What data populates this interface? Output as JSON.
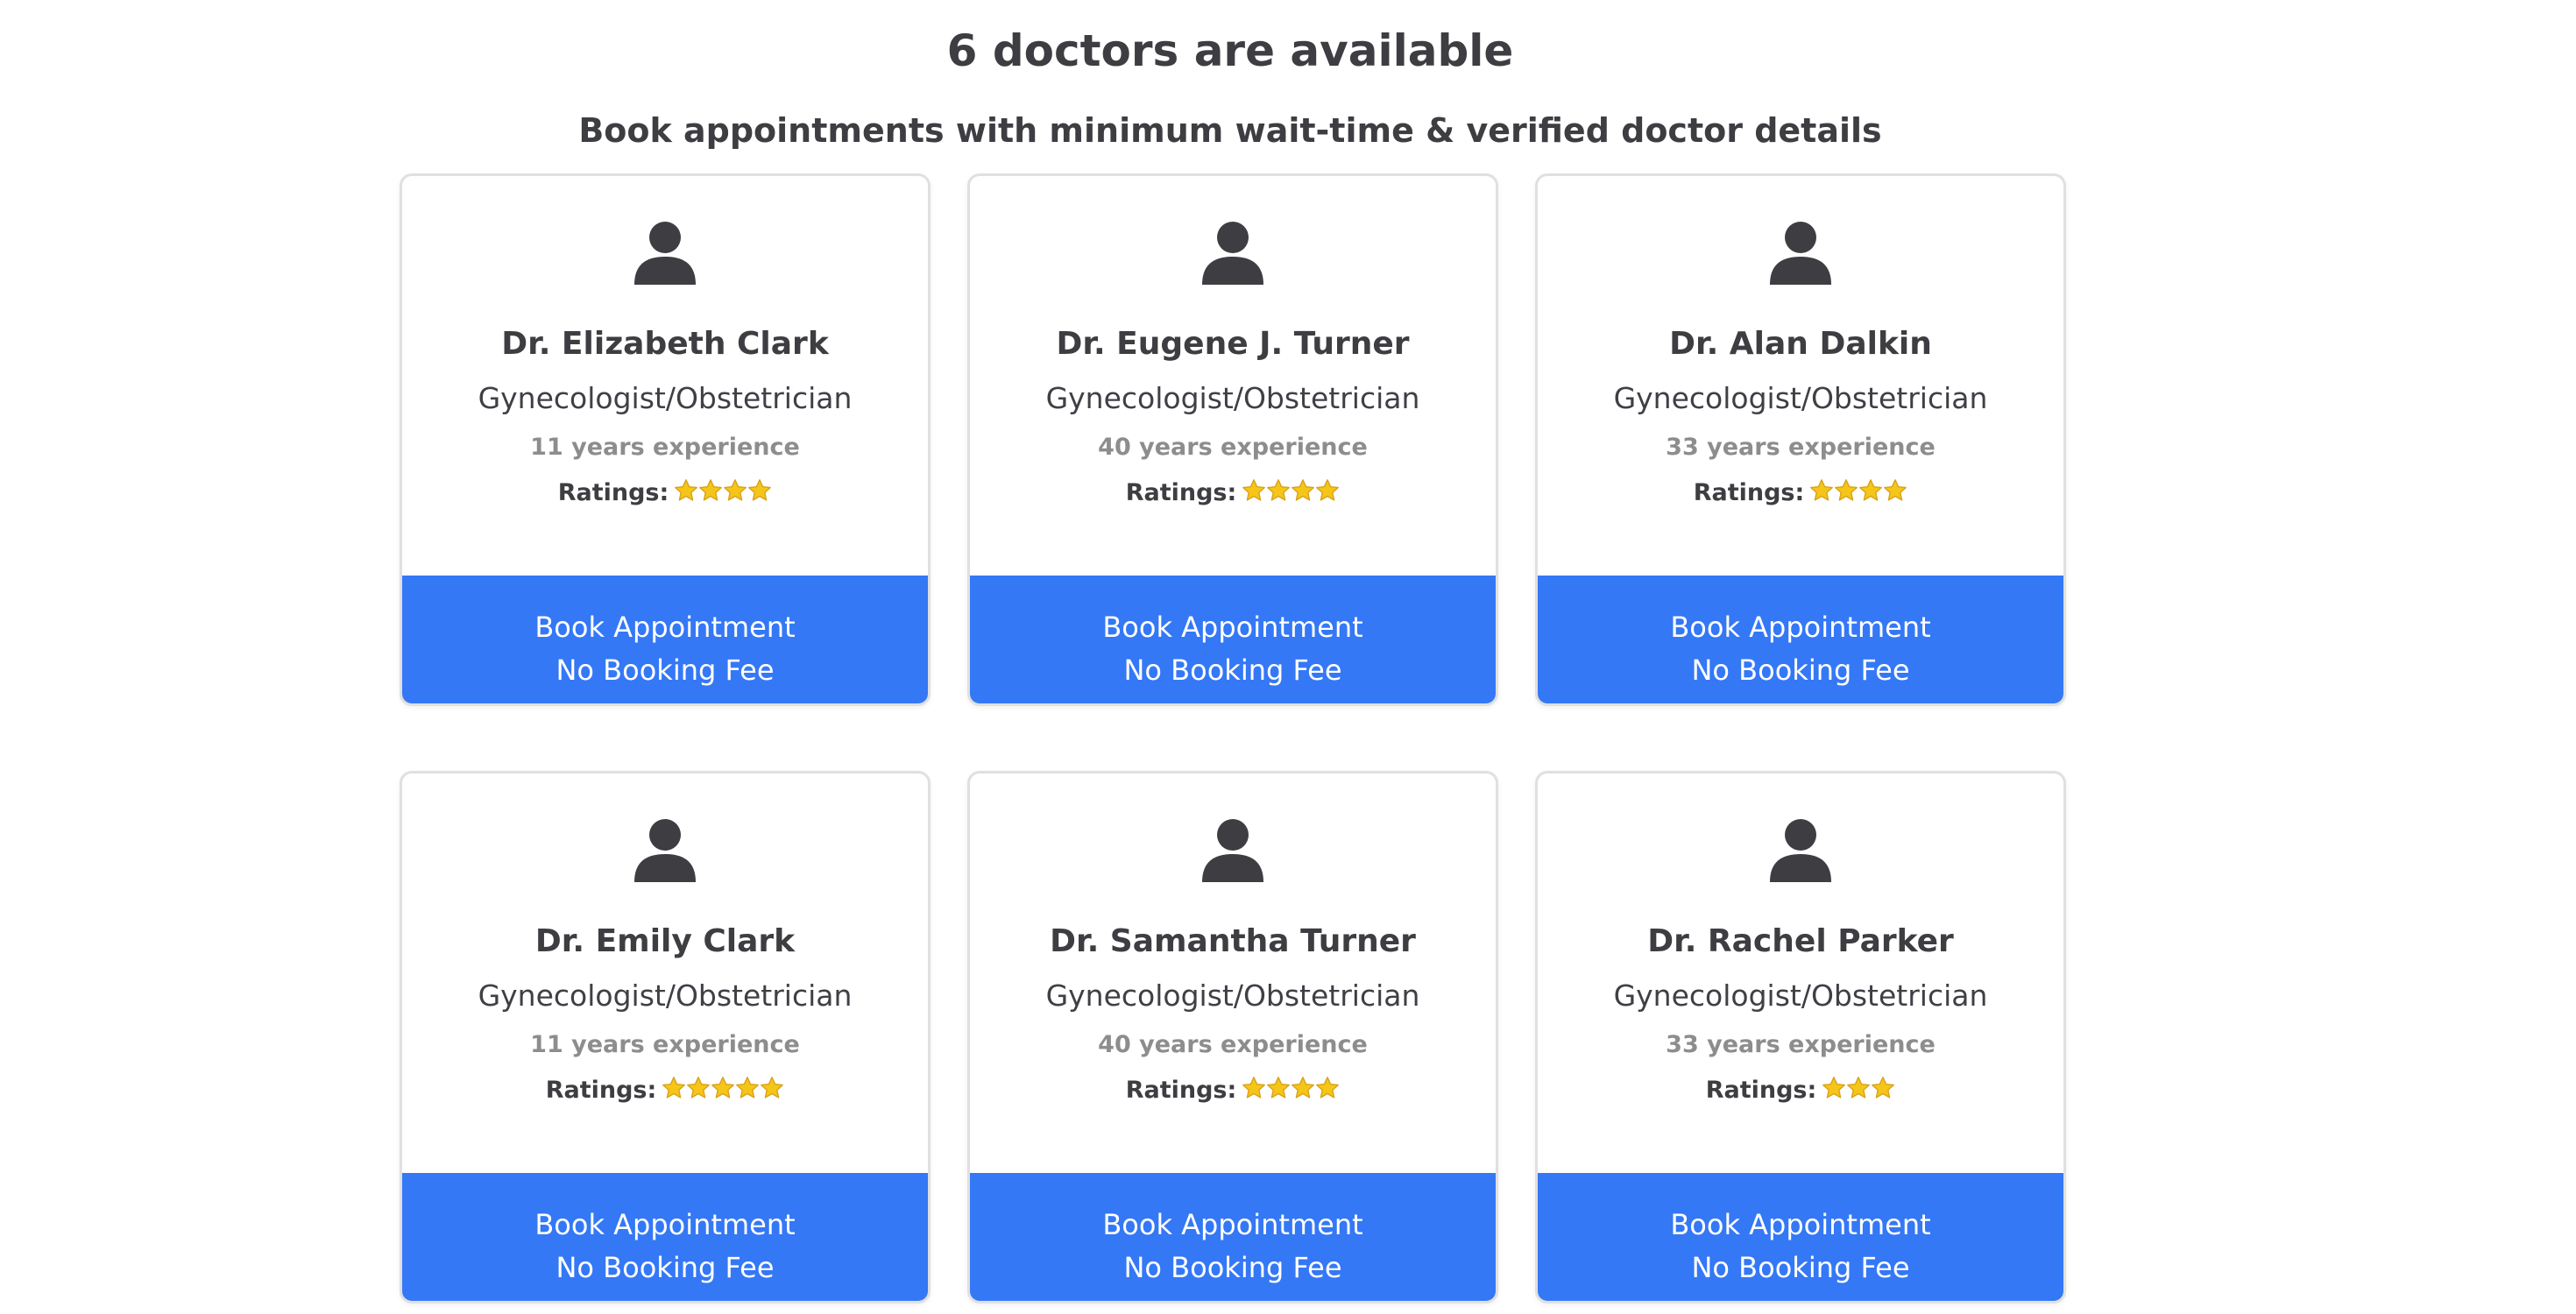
{
  "header": {
    "available_text": "6 doctors are available",
    "subtitle": "Book appointments with minimum wait-time & verified doctor details"
  },
  "colors": {
    "button": "#3478f6",
    "text_dark": "#3d3d42",
    "text_muted": "#8d8d8d",
    "star": "#f5c518"
  },
  "ratings_label": "Ratings:",
  "doctors": [
    {
      "name": "Dr. Elizabeth Clark",
      "specialty": "Gynecologist/Obstetrician",
      "experience": "11 years experience",
      "stars": 4,
      "button_line1": "Book Appointment",
      "button_line2": "No Booking Fee",
      "icon": "user-icon"
    },
    {
      "name": "Dr. Eugene J. Turner",
      "specialty": "Gynecologist/Obstetrician",
      "experience": "40 years experience",
      "stars": 4,
      "button_line1": "Book Appointment",
      "button_line2": "No Booking Fee",
      "icon": "user-icon"
    },
    {
      "name": "Dr. Alan Dalkin",
      "specialty": "Gynecologist/Obstetrician",
      "experience": "33 years experience",
      "stars": 4,
      "button_line1": "Book Appointment",
      "button_line2": "No Booking Fee",
      "icon": "user-icon"
    },
    {
      "name": "Dr. Emily Clark",
      "specialty": "Gynecologist/Obstetrician",
      "experience": "11 years experience",
      "stars": 5,
      "button_line1": "Book Appointment",
      "button_line2": "No Booking Fee",
      "icon": "user-icon"
    },
    {
      "name": "Dr. Samantha Turner",
      "specialty": "Gynecologist/Obstetrician",
      "experience": "40 years experience",
      "stars": 4,
      "button_line1": "Book Appointment",
      "button_line2": "No Booking Fee",
      "icon": "user-icon"
    },
    {
      "name": "Dr. Rachel Parker",
      "specialty": "Gynecologist/Obstetrician",
      "experience": "33 years experience",
      "stars": 3,
      "button_line1": "Book Appointment",
      "button_line2": "No Booking Fee",
      "icon": "user-icon"
    }
  ]
}
